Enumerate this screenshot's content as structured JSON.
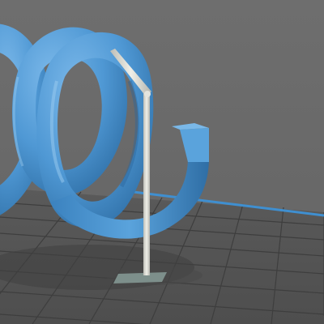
{
  "viewport": {
    "background_color": "#6b6b6b",
    "floor_color": "#545454",
    "grid_line_color": "#3d3d3d",
    "boundary_line_color": "#3f8fd0"
  },
  "model": {
    "name": "helix-spring",
    "color": "#4f98d4",
    "shadow_color": "#26577f",
    "highlight_color": "#8cc4ee"
  },
  "support": {
    "color": "#dcdcd4",
    "base_color": "#7d8f8b",
    "selected": false
  }
}
